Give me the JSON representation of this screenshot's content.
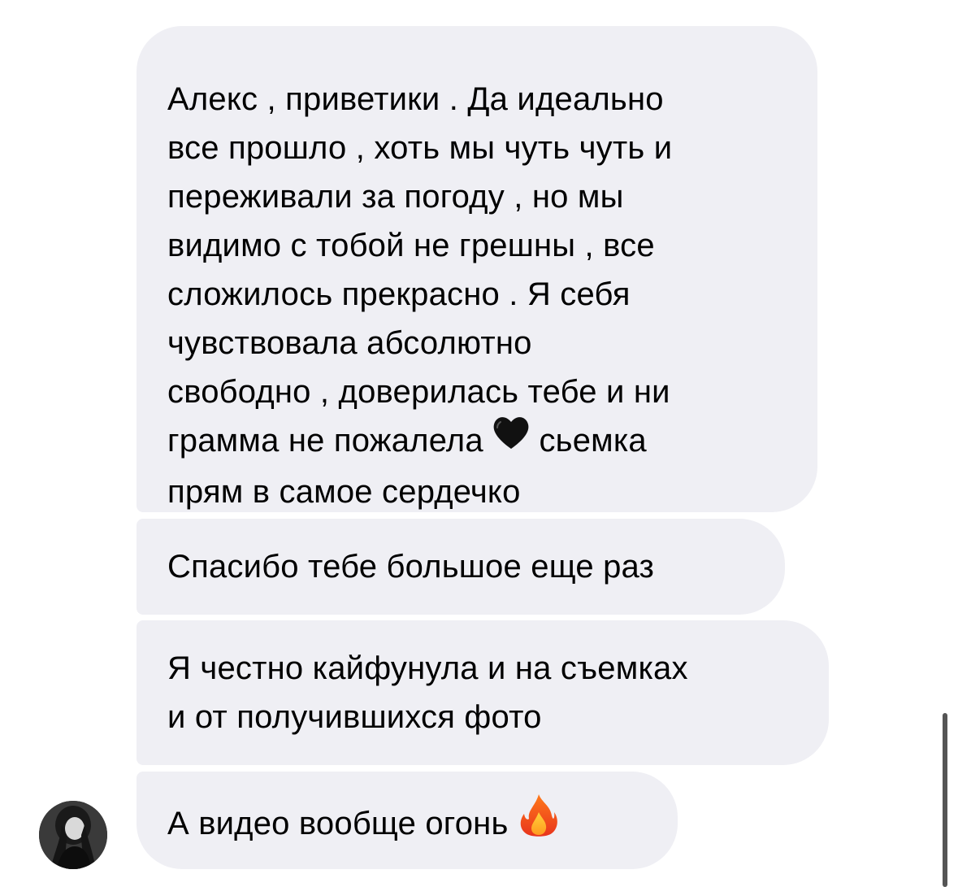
{
  "messages": [
    {
      "line1": "Алекс , приветики . Да идеально",
      "line2": "все прошло , хоть мы чуть чуть и",
      "line3": "переживали за погоду , но мы",
      "line4": "видимо с тобой не грешны , все",
      "line5": "сложилось прекрасно . Я себя",
      "line6": "чувствовала абсолютно",
      "line7": "свободно , доверилась тебе и ни",
      "line8a": "грамма не пожалела",
      "line8b": "сьемка",
      "line9": "прям в самое сердечко",
      "emoji": "black-heart-icon"
    },
    {
      "line1": "Спасибо тебе большое еще раз"
    },
    {
      "line1": "Я честно кайфунула и на съемках",
      "line2": "и от получившихся фото"
    },
    {
      "line1": "А видео вообще огонь",
      "emoji": "fire-icon"
    }
  ],
  "colors": {
    "bubble": "#efeff4",
    "text": "#000000",
    "scrollbar": "#555555"
  },
  "avatar": {
    "icon": "user-avatar"
  }
}
